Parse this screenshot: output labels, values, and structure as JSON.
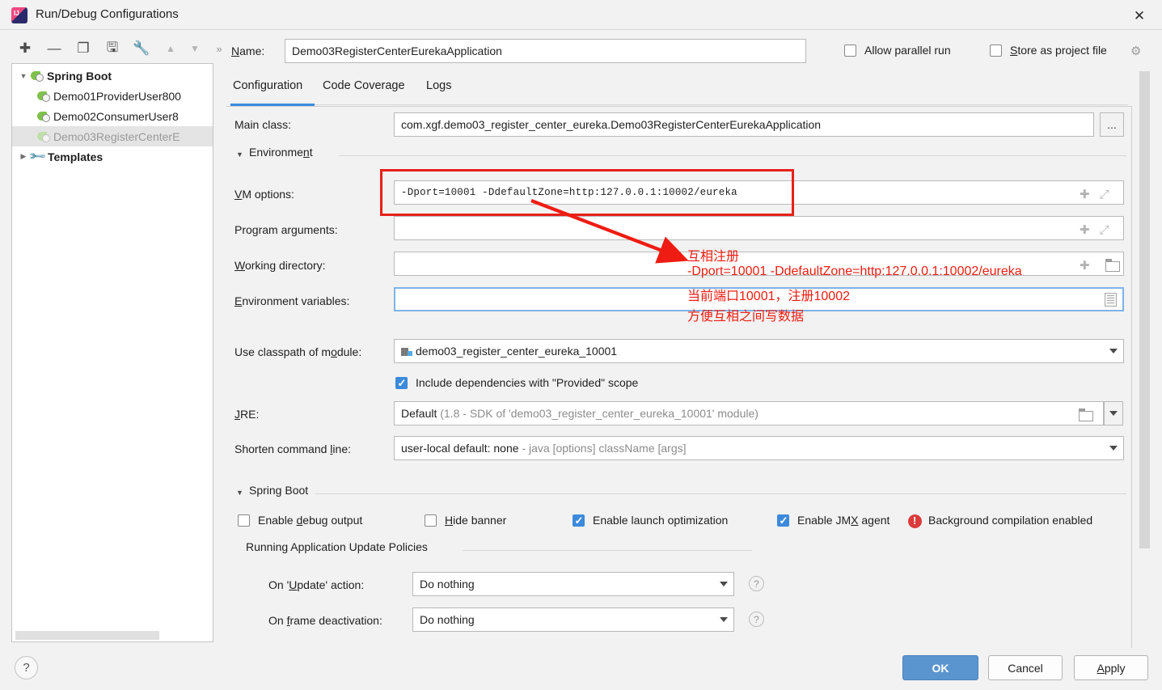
{
  "window": {
    "title": "Run/Debug Configurations",
    "app_icon": "intellij-idea-icon",
    "close_icon": "close-icon"
  },
  "toolbar": {
    "icons": [
      {
        "name": "add-icon",
        "glyph": "+"
      },
      {
        "name": "remove-icon",
        "glyph": "−"
      },
      {
        "name": "copy-icon",
        "glyph": "❐"
      },
      {
        "name": "save-icon",
        "glyph": "💾"
      },
      {
        "name": "edit-templates-icon",
        "glyph": "🔧"
      },
      {
        "name": "move-up-icon",
        "glyph": "▲"
      },
      {
        "name": "move-down-icon",
        "glyph": "▼"
      },
      {
        "name": "more-icon",
        "glyph": "»"
      }
    ]
  },
  "tree": {
    "nodes": [
      {
        "label": "Spring Boot",
        "type": "group",
        "expanded": true,
        "bold": true,
        "selected": false
      },
      {
        "label": "Demo01ProviderUser800",
        "type": "config",
        "selected": false
      },
      {
        "label": "Demo02ConsumerUser8",
        "type": "config",
        "selected": false
      },
      {
        "label": "Demo03RegisterCenterE",
        "type": "config",
        "selected": true
      },
      {
        "label": "Templates",
        "type": "templates",
        "expanded": false,
        "bold": true,
        "selected": false
      }
    ]
  },
  "header": {
    "name_label": "Name:",
    "name_value": "Demo03RegisterCenterEurekaApplication",
    "allow_parallel_run": {
      "label": "Allow parallel run",
      "checked": false
    },
    "store_as_project_file": {
      "label": "Store as project file",
      "checked": false
    },
    "gear_icon": "gear-icon"
  },
  "tabs": {
    "items": [
      {
        "label": "Configuration",
        "active": true
      },
      {
        "label": "Code Coverage",
        "active": false
      },
      {
        "label": "Logs",
        "active": false
      }
    ]
  },
  "form": {
    "main_class": {
      "label": "Main class:",
      "value": "com.xgf.demo03_register_center_eureka.Demo03RegisterCenterEurekaApplication",
      "browse_label": "..."
    },
    "environment_section": "Environment",
    "vm_options": {
      "label": "VM options:",
      "value": "-Dport=10001 -DdefaultZone=http:127.0.0.1:10002/eureka"
    },
    "program_arguments": {
      "label": "Program arguments:",
      "value": ""
    },
    "working_directory": {
      "label": "Working directory:",
      "value": ""
    },
    "environment_variables": {
      "label": "Environment variables:",
      "value": "",
      "focused": true
    },
    "use_classpath_of_module": {
      "label": "Use classpath of module:",
      "value": "demo03_register_center_eureka_10001"
    },
    "include_provided": {
      "label": "Include dependencies with \"Provided\" scope",
      "checked": true
    },
    "jre": {
      "label": "JRE:",
      "value_main": "Default",
      "value_dim": "(1.8 - SDK of 'demo03_register_center_eureka_10001' module)"
    },
    "shorten_command_line": {
      "label": "Shorten command line:",
      "value_main": "user-local default: none",
      "value_dim": "- java [options] className [args]"
    }
  },
  "spring_boot": {
    "section_title": "Spring Boot",
    "checkboxes": [
      {
        "label": "Enable debug output",
        "checked": false
      },
      {
        "label": "Hide banner",
        "checked": false
      },
      {
        "label": "Enable launch optimization",
        "checked": true
      },
      {
        "label": "Enable JMX agent",
        "checked": true
      }
    ],
    "background_compilation": {
      "label": "Background compilation enabled",
      "icon": "error-badge-icon"
    },
    "update_policies": {
      "title": "Running Application Update Policies",
      "rows": [
        {
          "label": "On 'Update' action:",
          "value": "Do nothing",
          "help_icon": "help-icon"
        },
        {
          "label": "On frame deactivation:",
          "value": "Do nothing",
          "help_icon": "help-icon"
        }
      ]
    }
  },
  "footer": {
    "help_icon": "help-icon",
    "ok": "OK",
    "cancel": "Cancel",
    "apply": "Apply"
  },
  "annotations": {
    "color": "#ee1c12",
    "highlight_box": "vm-options-highlight",
    "arrow": "red-arrow",
    "lines": [
      "互相注册",
      "-Dport=10001 -DdefaultZone=http:127.0.0.1:10002/eureka",
      "当前端口10001，注册10002",
      "方便互相之间写数据"
    ]
  }
}
